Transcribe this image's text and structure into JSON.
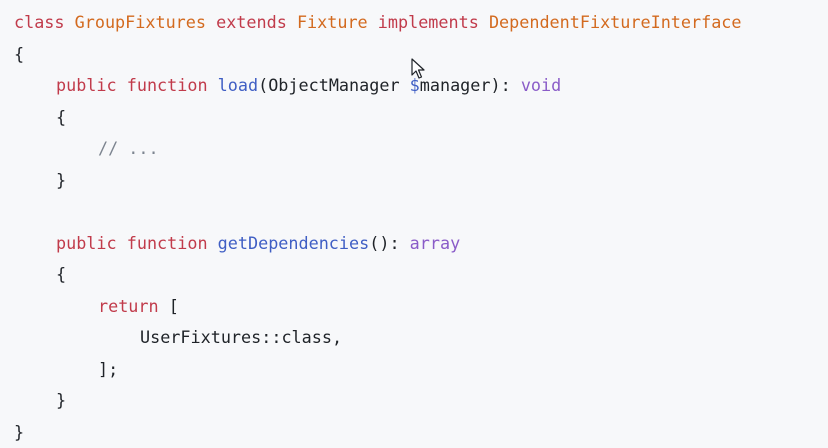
{
  "code": {
    "line1": {
      "class_kw": "class",
      "class_name": "GroupFixtures",
      "extends_kw": "extends",
      "parent": "Fixture",
      "implements_kw": "implements",
      "interface": "DependentFixtureInterface"
    },
    "line2": {
      "brace": "{"
    },
    "line3": {
      "public_kw": "public",
      "function_kw": "function",
      "name": "load",
      "open_paren": "(",
      "param_type": "ObjectManager",
      "param_dollar": "$",
      "param_name": "manager",
      "close": "): ",
      "return_type": "void"
    },
    "line4": {
      "brace": "{"
    },
    "line5": {
      "comment": "// ..."
    },
    "line6": {
      "brace": "}"
    },
    "line8": {
      "public_kw": "public",
      "function_kw": "function",
      "name": "getDependencies",
      "parens": "(): ",
      "return_type": "array"
    },
    "line9": {
      "brace": "{"
    },
    "line10": {
      "return_kw": "return",
      "bracket": "["
    },
    "line11": {
      "text": "UserFixtures::class,"
    },
    "line12": {
      "text": "];"
    },
    "line13": {
      "brace": "}"
    },
    "line14": {
      "brace": "}"
    }
  },
  "colors": {
    "keyword": "#c13b4b",
    "class_name": "#d36a1f",
    "function": "#3f5ec4",
    "type": "#8a5cc8",
    "comment": "#7d8590",
    "background": "#f7f8fa"
  },
  "icons": {
    "cursor": "mouse-pointer-icon"
  }
}
